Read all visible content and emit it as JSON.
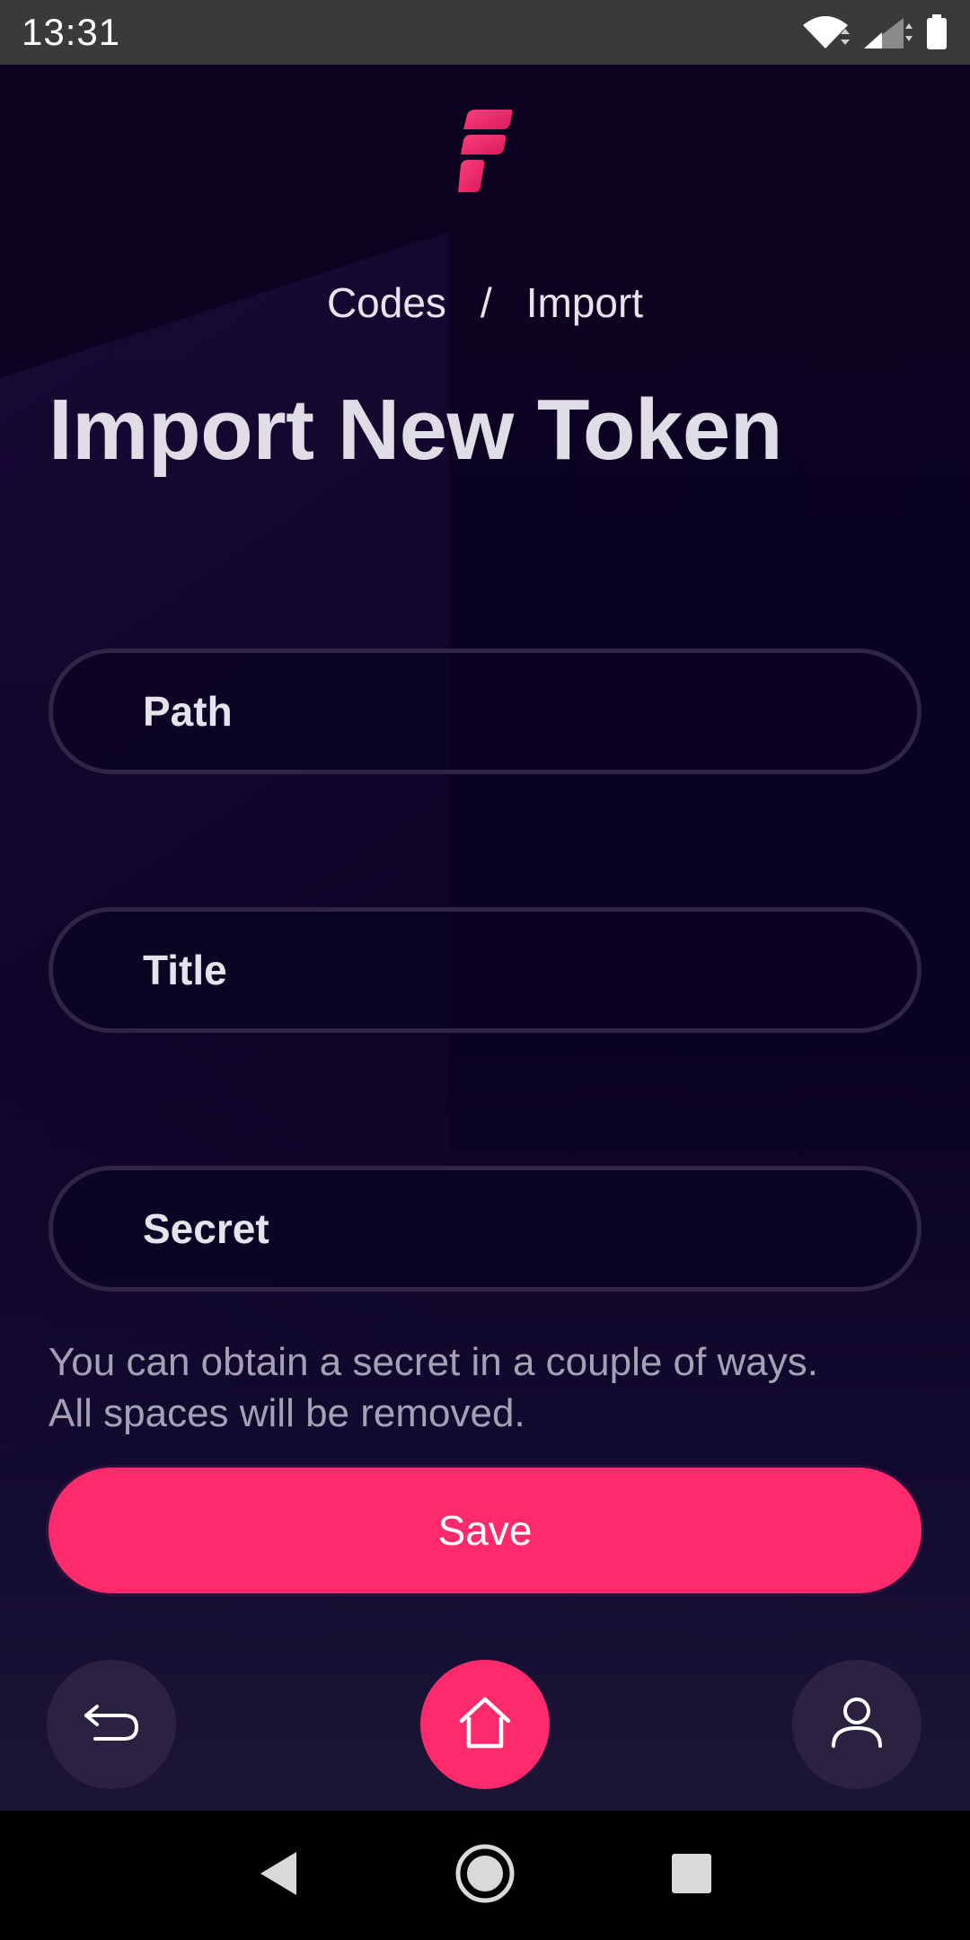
{
  "status_bar": {
    "time": "13:31",
    "icons": [
      "wifi-icon",
      "cell-signal-icon",
      "battery-icon"
    ]
  },
  "app": {
    "logo": "app-logo-icon",
    "breadcrumb": {
      "items": [
        "Codes",
        "Import"
      ],
      "separator": "/"
    },
    "title": "Import New Token",
    "fields": {
      "path_label": "Path",
      "title_label": "Title",
      "secret_label": "Secret"
    },
    "hint": {
      "line1": "You can obtain a secret in a couple of ways.",
      "line2": "All spaces will be removed."
    },
    "save_label": "Save",
    "bottom_nav": {
      "back_icon": "back-arrow-icon",
      "home_icon": "home-icon",
      "profile_icon": "user-icon"
    }
  },
  "nav_bar": {
    "icons": [
      "back-triangle-icon",
      "home-circle-icon",
      "recents-square-icon"
    ]
  },
  "colors": {
    "accent": "#ff2a6c",
    "background": "#0b0320",
    "field_border": "#2f2646",
    "button_dark": "#2b2242"
  }
}
